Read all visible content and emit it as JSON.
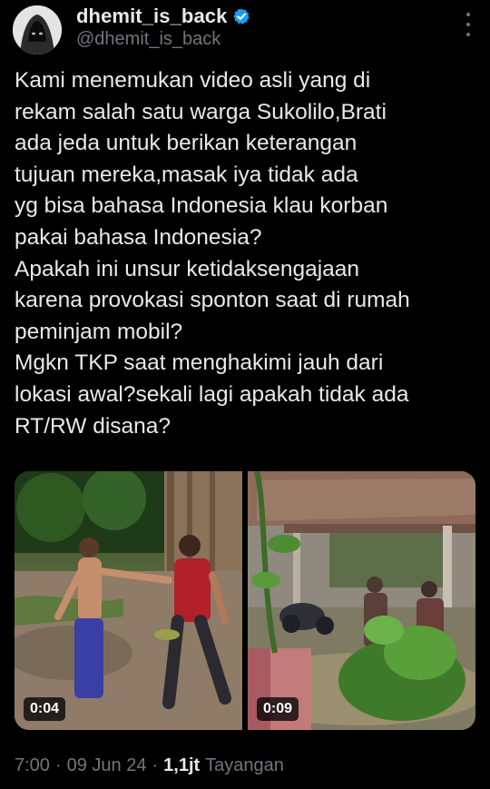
{
  "author": {
    "display_name": "dhemit_is_back",
    "handle": "@dhemit_is_back",
    "verified_color": "#1d9bf0"
  },
  "tweet": {
    "lines": [
      "Kami menemukan video asli yang di",
      "rekam salah satu warga Sukolilo,Brati",
      "ada jeda untuk berikan keterangan",
      "tujuan mereka,masak iya tidak ada",
      "yg bisa bahasa Indonesia klau korban",
      "pakai bahasa Indonesia?",
      "Apakah ini unsur ketidaksengajaan",
      "karena provokasi sponton saat di rumah",
      "peminjam mobil?",
      "Mgkn TKP saat menghakimi jauh dari",
      "lokasi awal?sekali lagi apakah tidak ada",
      "RT/RW disana?"
    ]
  },
  "media": [
    {
      "duration": "0:04"
    },
    {
      "duration": "0:09"
    }
  ],
  "meta": {
    "time": "7:00",
    "date": "09 Jun 24",
    "views_count": "1,1jt",
    "views_label": "Tayangan",
    "separator": "·"
  },
  "colors": {
    "background": "#000000",
    "text": "#e7e9ea",
    "secondary": "#71767b"
  }
}
